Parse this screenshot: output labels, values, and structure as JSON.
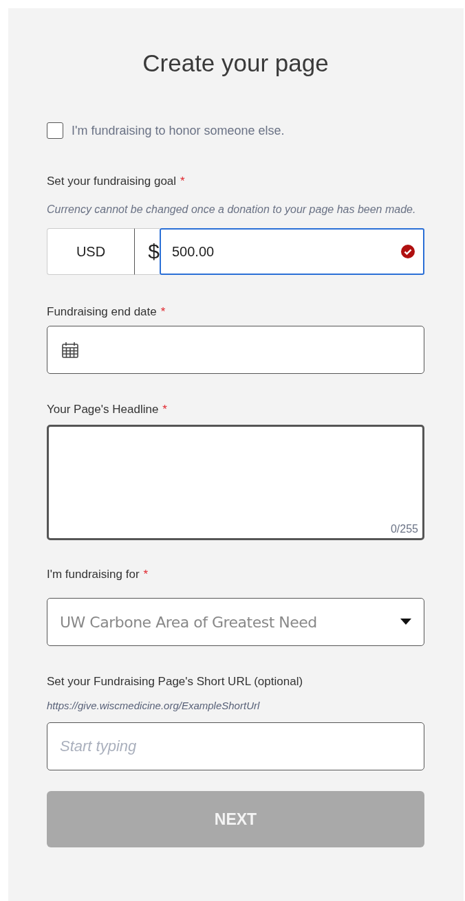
{
  "title": "Create your page",
  "honor_checkbox": {
    "label": "I'm fundraising to honor someone else.",
    "checked": false
  },
  "goal": {
    "label": "Set your fundraising goal",
    "required_mark": "*",
    "help": "Currency cannot be changed once a donation to your page has been made.",
    "currency": "USD",
    "symbol": "$",
    "amount": "500.00",
    "valid": true
  },
  "end_date": {
    "label": "Fundraising end date",
    "required_mark": "*"
  },
  "headline": {
    "label": "Your Page's Headline",
    "required_mark": "*",
    "counter": "0/255"
  },
  "fundraising_for": {
    "label": "I'm fundraising for",
    "required_mark": "*",
    "value": "UW Carbone Area of Greatest Need"
  },
  "short_url": {
    "label": "Set your Fundraising Page's Short URL (optional)",
    "example": "https://give.wiscmedicine.org/ExampleShortUrl",
    "placeholder": "Start typing"
  },
  "next_button": {
    "label": "NEXT",
    "disabled": true
  }
}
